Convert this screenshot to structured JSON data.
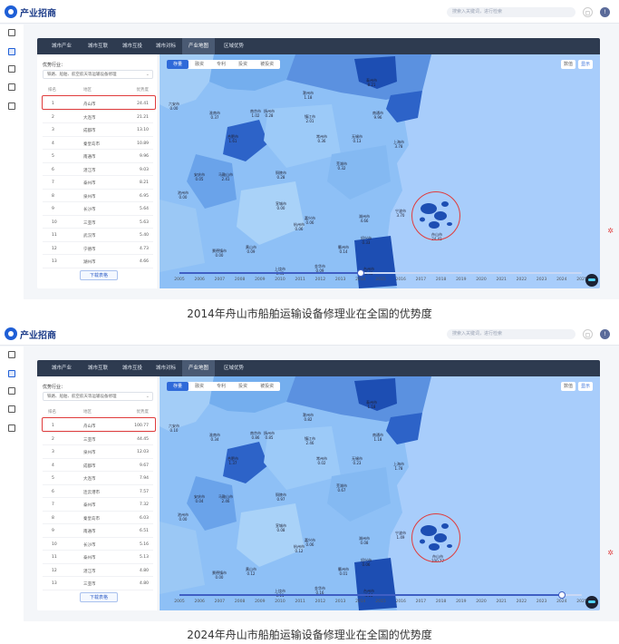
{
  "app": {
    "logo_text": "产业招商",
    "logo_sub": "",
    "search_placeholder": "搜索入关键词，进行检索"
  },
  "tabs": [
    "城市产业",
    "城市互联",
    "城市互投",
    "城市对标",
    "产业地图",
    "区域优势"
  ],
  "active_tab": "产业地图",
  "filter_label": "优势行业：",
  "filter_value": "铁路、船舶、航空航天等运输设备修理",
  "table_headers": {
    "rank": "排名",
    "name": "地区",
    "val": "优势度"
  },
  "download_label": "下载表格",
  "map_tabs": [
    "存量",
    "融资",
    "专利",
    "投资",
    "被投资"
  ],
  "map_controls": [
    "数值",
    "显示"
  ],
  "colors": {
    "sea": "#a8cdfb",
    "dark": "#1d4eb3",
    "mid": "#5b91e0",
    "light": "#8ec0f6",
    "pale": "#bedbfa",
    "accent": "#3f5fc4",
    "alert": "#e03c3c"
  },
  "years": [
    "2005",
    "2006",
    "2007",
    "2008",
    "2009",
    "2010",
    "2011",
    "2012",
    "2013",
    "2014",
    "2015",
    "2016",
    "2017",
    "2018",
    "2019",
    "2020",
    "2021",
    "2022",
    "2023",
    "2024",
    "2025"
  ],
  "shot1": {
    "caption": "2014年舟山市船舶运输设备修理业在全国的优势度",
    "current_year_index": 9,
    "rows": [
      {
        "rank": "1",
        "name": "舟山市",
        "val": "24.41"
      },
      {
        "rank": "2",
        "name": "大连市",
        "val": "21.21"
      },
      {
        "rank": "3",
        "name": "成都市",
        "val": "13.10"
      },
      {
        "rank": "4",
        "name": "秦皇岛市",
        "val": "10.89"
      },
      {
        "rank": "5",
        "name": "南通市",
        "val": "9.96"
      },
      {
        "rank": "6",
        "name": "湛江市",
        "val": "9.03"
      },
      {
        "rank": "7",
        "name": "泰州市",
        "val": "8.21"
      },
      {
        "rank": "8",
        "name": "泉州市",
        "val": "6.95"
      },
      {
        "rank": "9",
        "name": "长沙市",
        "val": "5.64"
      },
      {
        "rank": "10",
        "name": "三亚市",
        "val": "5.63"
      },
      {
        "rank": "11",
        "name": "武汉市",
        "val": "5.40"
      },
      {
        "rank": "12",
        "name": "宁德市",
        "val": "4.73"
      },
      {
        "rank": "13",
        "name": "湖州市",
        "val": "4.66"
      }
    ],
    "regions": [
      {
        "name": "六安市",
        "val": "0.00"
      },
      {
        "name": "淮南市",
        "val": "0.37"
      },
      {
        "name": "滁州市",
        "val": "1.18"
      },
      {
        "name": "扬州市",
        "val": "0.28"
      },
      {
        "name": "泰州市",
        "val": "8.21"
      },
      {
        "name": "南通市",
        "val": "9.96"
      },
      {
        "name": "南京市",
        "val": "1.02"
      },
      {
        "name": "镇江市",
        "val": "2.01"
      },
      {
        "name": "常州市",
        "val": "0.36"
      },
      {
        "name": "无锡市",
        "val": "0.13"
      },
      {
        "name": "上海市",
        "val": "3.78"
      },
      {
        "name": "合肥市",
        "val": "1.61"
      },
      {
        "name": "马鞍山市",
        "val": "2.41"
      },
      {
        "name": "芜湖市",
        "val": "0.32"
      },
      {
        "name": "安庆市",
        "val": "0.05"
      },
      {
        "name": "铜陵市",
        "val": "0.28"
      },
      {
        "name": "宣城市",
        "val": "0.00"
      },
      {
        "name": "湖州市",
        "val": "4.66"
      },
      {
        "name": "嘉兴市",
        "val": "0.06"
      },
      {
        "name": "杭州市",
        "val": "0.06"
      },
      {
        "name": "绍兴市",
        "val": "0.33"
      },
      {
        "name": "宁波市",
        "val": "3.70"
      },
      {
        "name": "舟山市",
        "val": "24.41"
      },
      {
        "name": "池州市",
        "val": "0.00"
      },
      {
        "name": "黄山市",
        "val": "0.09"
      },
      {
        "name": "衢州市",
        "val": "0.14"
      },
      {
        "name": "金华市",
        "val": "0.09"
      },
      {
        "name": "台州市",
        "val": "0.43"
      },
      {
        "name": "上饶市",
        "val": "0.41"
      },
      {
        "name": "景德镇市",
        "val": "0.00"
      }
    ]
  },
  "shot2": {
    "caption": "2024年舟山市船舶运输设备修理业在全国的优势度",
    "current_year_index": 19,
    "rows": [
      {
        "rank": "1",
        "name": "舟山市",
        "val": "100.77"
      },
      {
        "rank": "2",
        "name": "三亚市",
        "val": "44.45"
      },
      {
        "rank": "3",
        "name": "泉州市",
        "val": "12.03"
      },
      {
        "rank": "4",
        "name": "成都市",
        "val": "9.67"
      },
      {
        "rank": "5",
        "name": "大连市",
        "val": "7.94"
      },
      {
        "rank": "6",
        "name": "连云港市",
        "val": "7.57"
      },
      {
        "rank": "7",
        "name": "泰州市",
        "val": "7.32"
      },
      {
        "rank": "8",
        "name": "秦皇岛市",
        "val": "6.03"
      },
      {
        "rank": "9",
        "name": "南通市",
        "val": "6.51"
      },
      {
        "rank": "10",
        "name": "长沙市",
        "val": "5.16"
      },
      {
        "rank": "11",
        "name": "泰州市",
        "val": "5.13"
      },
      {
        "rank": "12",
        "name": "湛江市",
        "val": "4.80"
      },
      {
        "rank": "13",
        "name": "三亚市",
        "val": "4.80"
      }
    ],
    "regions": [
      {
        "name": "六安市",
        "val": "0.10"
      },
      {
        "name": "淮南市",
        "val": "0.34"
      },
      {
        "name": "滁州市",
        "val": "0.82"
      },
      {
        "name": "扬州市",
        "val": "0.85"
      },
      {
        "name": "泰州市",
        "val": "1.18"
      },
      {
        "name": "南通市",
        "val": "1.18"
      },
      {
        "name": "南京市",
        "val": "0.86"
      },
      {
        "name": "镇江市",
        "val": "2.46"
      },
      {
        "name": "常州市",
        "val": "0.02"
      },
      {
        "name": "无锡市",
        "val": "0.23"
      },
      {
        "name": "上海市",
        "val": "1.78"
      },
      {
        "name": "合肥市",
        "val": "1.37"
      },
      {
        "name": "马鞍山市",
        "val": "2.46"
      },
      {
        "name": "芜湖市",
        "val": "0.67"
      },
      {
        "name": "安庆市",
        "val": "0.04"
      },
      {
        "name": "铜陵市",
        "val": "0.97"
      },
      {
        "name": "宣城市",
        "val": "0.08"
      },
      {
        "name": "湖州市",
        "val": "0.08"
      },
      {
        "name": "嘉兴市",
        "val": "0.06"
      },
      {
        "name": "杭州市",
        "val": "0.12"
      },
      {
        "name": "绍兴市",
        "val": "0.06"
      },
      {
        "name": "宁波市",
        "val": "1.49"
      },
      {
        "name": "舟山市",
        "val": "100.77"
      },
      {
        "name": "池州市",
        "val": "0.00"
      },
      {
        "name": "黄山市",
        "val": "0.12"
      },
      {
        "name": "衢州市",
        "val": "0.01"
      },
      {
        "name": "金华市",
        "val": "0.16"
      },
      {
        "name": "台州市",
        "val": "4.16"
      },
      {
        "name": "上饶市",
        "val": "0.11"
      },
      {
        "name": "景德镇市",
        "val": "0.00"
      }
    ]
  }
}
